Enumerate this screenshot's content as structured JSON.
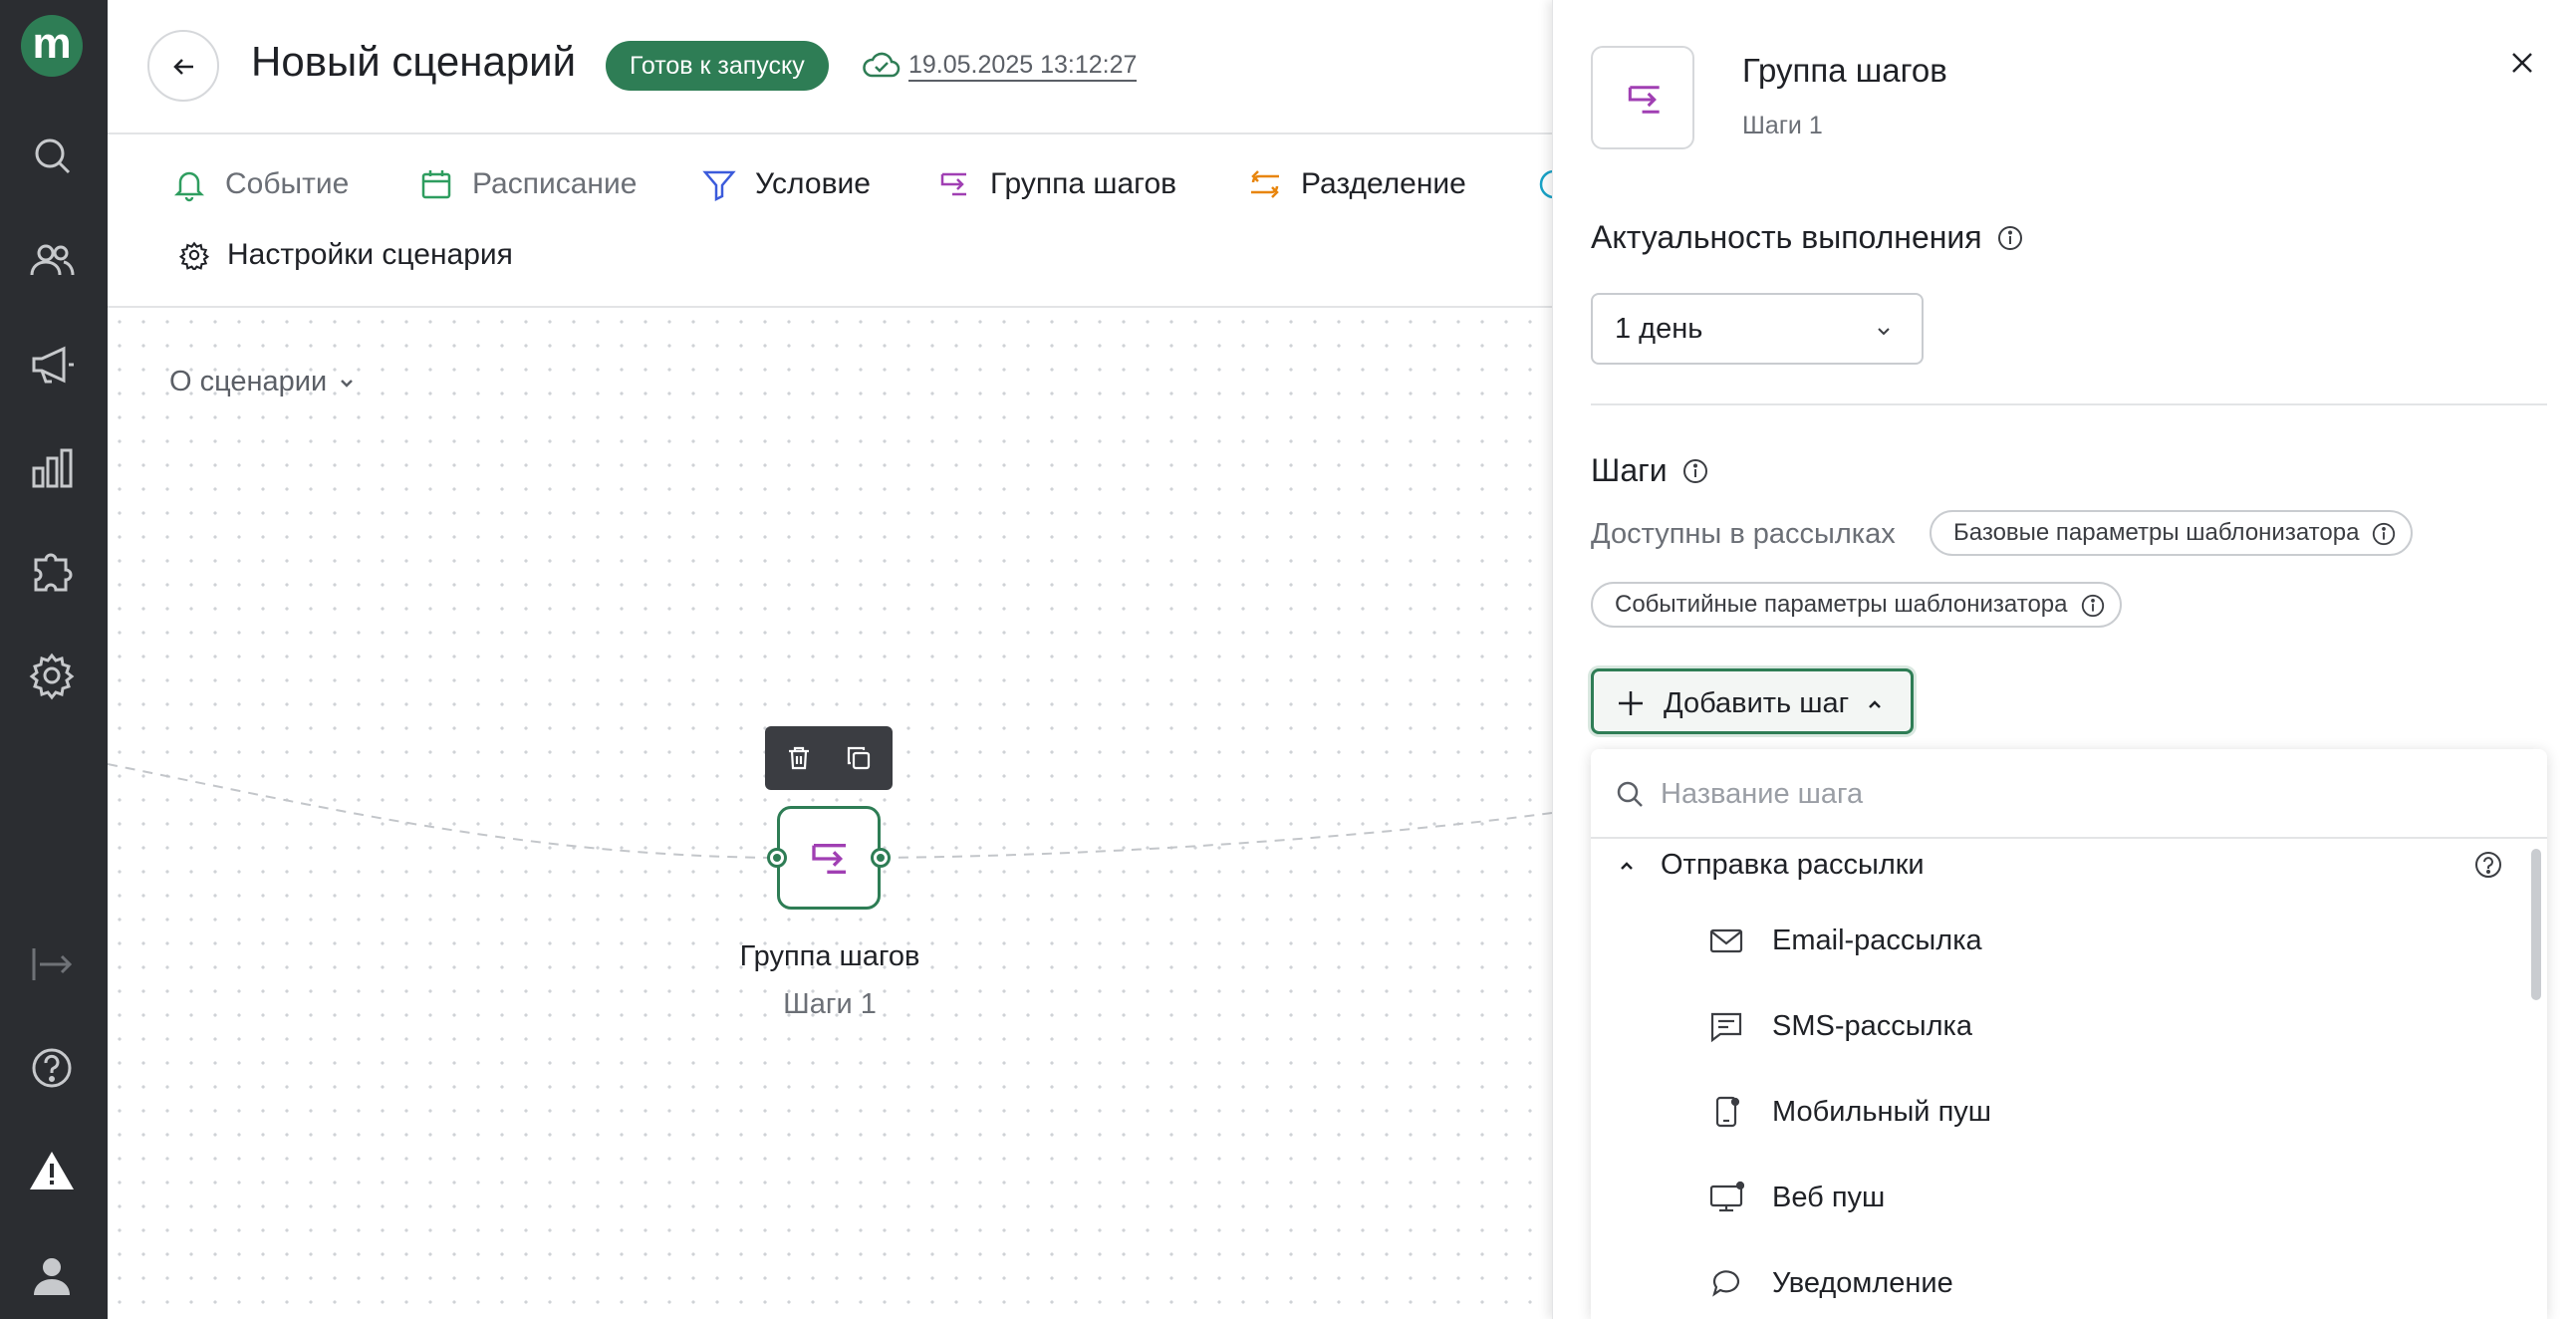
{
  "app": {
    "logo_letter": "m",
    "accent_color": "#2e7d55"
  },
  "rail": {
    "icons": [
      "search-icon",
      "users-icon",
      "megaphone-icon",
      "chart-icon",
      "puzzle-icon",
      "gear-icon",
      "expand-icon",
      "help-icon",
      "alert-icon",
      "user-icon"
    ]
  },
  "header": {
    "title": "Новый сценарий",
    "status": "Готов к запуску",
    "saved_at": "19.05.2025 13:12:27"
  },
  "toolbar": {
    "items": [
      {
        "label": "Событие",
        "icon": "bell-icon"
      },
      {
        "label": "Расписание",
        "icon": "calendar-icon"
      },
      {
        "label": "Условие",
        "icon": "filter-icon"
      },
      {
        "label": "Группа шагов",
        "icon": "step-group-icon"
      },
      {
        "label": "Разделение",
        "icon": "split-icon"
      }
    ],
    "settings_label": "Настройки сценария"
  },
  "canvas": {
    "about_label": "О сценарии",
    "node": {
      "title": "Группа шагов",
      "subtitle": "Шаги 1"
    }
  },
  "panel": {
    "title": "Группа шагов",
    "subtitle": "Шаги 1",
    "relevance": {
      "title": "Актуальность выполнения",
      "value": "1 день"
    },
    "steps": {
      "title": "Шаги",
      "available_label": "Доступны в рассылках",
      "chips": [
        "Базовые параметры шаблонизатора",
        "Событийные параметры шаблонизатора"
      ],
      "add_label": "Добавить шаг"
    },
    "dropdown": {
      "search_placeholder": "Название шага",
      "group_label": "Отправка рассылки",
      "options": [
        {
          "label": "Email-рассылка",
          "icon": "mail-icon"
        },
        {
          "label": "SMS-рассылка",
          "icon": "sms-icon"
        },
        {
          "label": "Мобильный пуш",
          "icon": "mobile-push-icon"
        },
        {
          "label": "Веб пуш",
          "icon": "web-push-icon"
        },
        {
          "label": "Уведомление",
          "icon": "notification-icon"
        }
      ]
    }
  }
}
